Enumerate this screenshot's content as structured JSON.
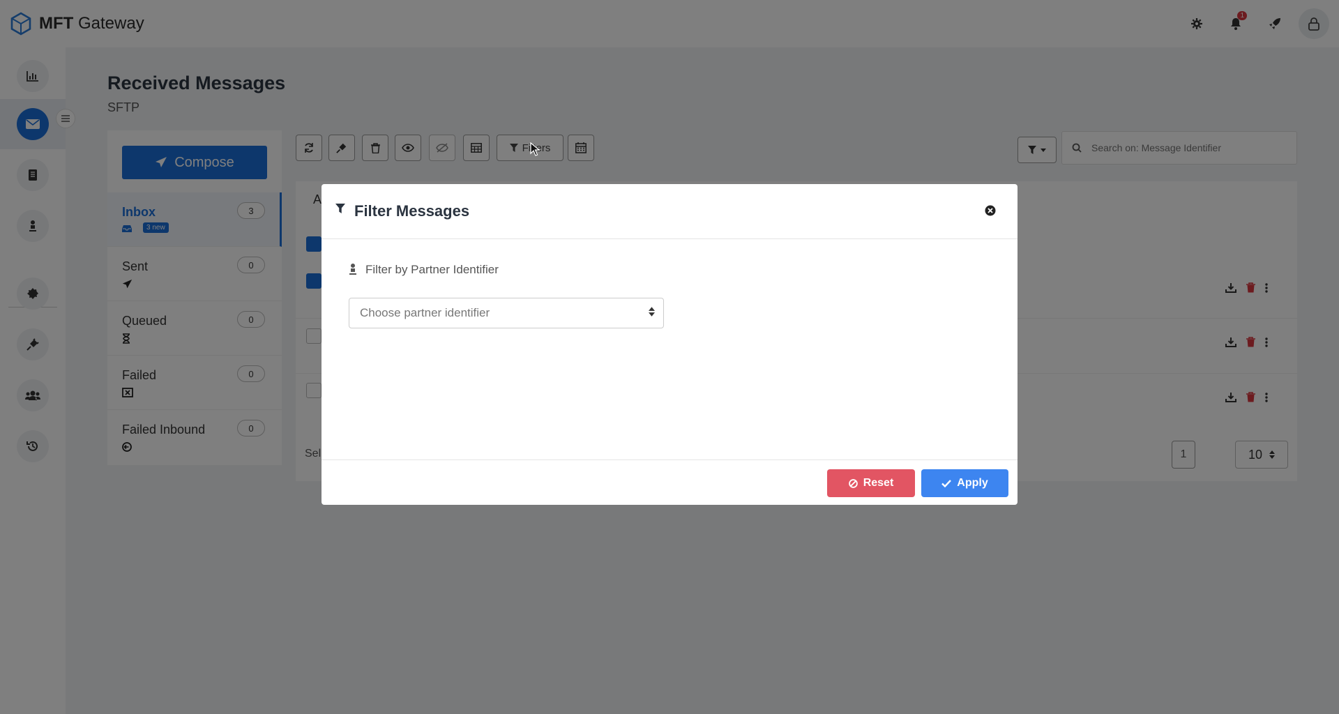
{
  "app": {
    "brand_bold": "MFT",
    "brand_rest": " Gateway",
    "notification_count": "1"
  },
  "page": {
    "title": "Received Messages",
    "subtitle": "SFTP"
  },
  "folders": {
    "compose_label": "Compose",
    "items": [
      {
        "label": "Inbox",
        "count": "3",
        "badge": "3 new",
        "icon": "inbox-icon"
      },
      {
        "label": "Sent",
        "count": "0",
        "icon": "paper-plane-icon"
      },
      {
        "label": "Queued",
        "count": "0",
        "icon": "hourglass-icon"
      },
      {
        "label": "Failed",
        "count": "0",
        "icon": "failed-box-icon"
      },
      {
        "label": "Failed Inbound",
        "count": "0",
        "icon": "arrow-circle-icon"
      }
    ]
  },
  "toolbar": {
    "filters_label": "Filters"
  },
  "search": {
    "placeholder": "Search on: Message Identifier"
  },
  "table": {
    "tab_initial": "A",
    "selection_text": "Sel",
    "current_page": "1",
    "page_size": "10"
  },
  "modal": {
    "title": "Filter Messages",
    "filter_label": "Filter by Partner Identifier",
    "select_placeholder": "Choose partner identifier",
    "reset_label": "Reset",
    "apply_label": "Apply"
  },
  "colors": {
    "primary": "#1a6ed8",
    "danger": "#e25563",
    "apply": "#3d85f0",
    "overlay": "rgba(0,0,0,0.5)"
  }
}
